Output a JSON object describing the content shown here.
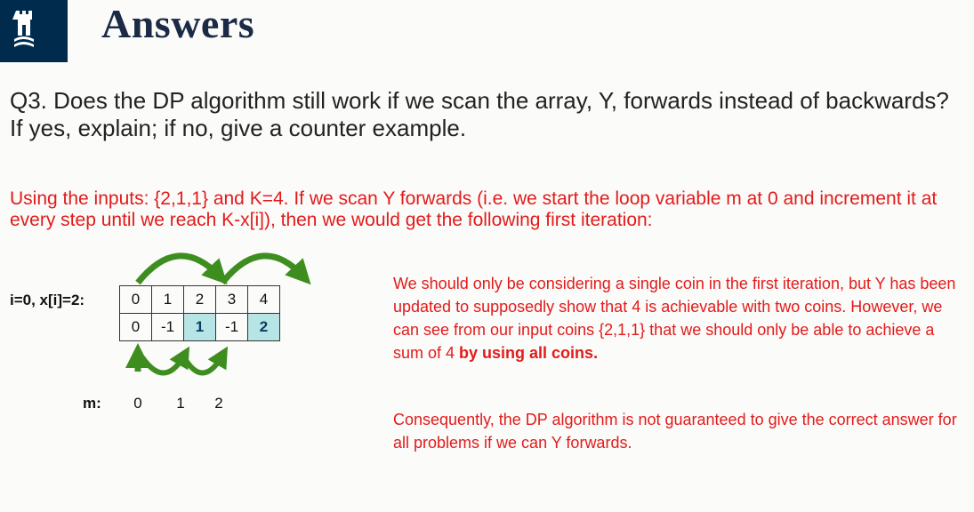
{
  "header": {
    "title": "Answers",
    "logo_icon": "castle-crest-icon",
    "logo_bg": "#002b4d"
  },
  "question": {
    "text": "Q3. Does the DP algorithm still work if we scan the array, Y, forwards instead of backwards? If yes, explain; if no, give a counter example."
  },
  "answer": {
    "intro": "Using the inputs: {2,1,1} and K=4. If we scan Y forwards (i.e. we start the loop variable m at 0 and increment it at every step until we reach K-x[i]), then we would get the following first iteration:",
    "row_label": "i=0, x[i]=2:",
    "index_row": [
      "0",
      "1",
      "2",
      "3",
      "4"
    ],
    "value_row": [
      "0",
      "-1",
      "1",
      "-1",
      "2"
    ],
    "m_label": "m:",
    "m_values": [
      "0",
      "1",
      "2"
    ],
    "explanation_part1": "We should only be considering a single coin in the first iteration, but  Y has been updated to supposedly show that 4 is achievable with two coins. However, we can see from our input coins {2,1,1} that we should only be able to achieve a sum of 4 ",
    "explanation_bold": "by using all coins.",
    "consequence": "Consequently, the DP algorithm is not guaranteed to give the correct answer for all problems if we can Y forwards.",
    "highlight_color": "#b7e4e4",
    "text_color": "#e21b1b",
    "arrow_color": "#3e8e1f"
  }
}
